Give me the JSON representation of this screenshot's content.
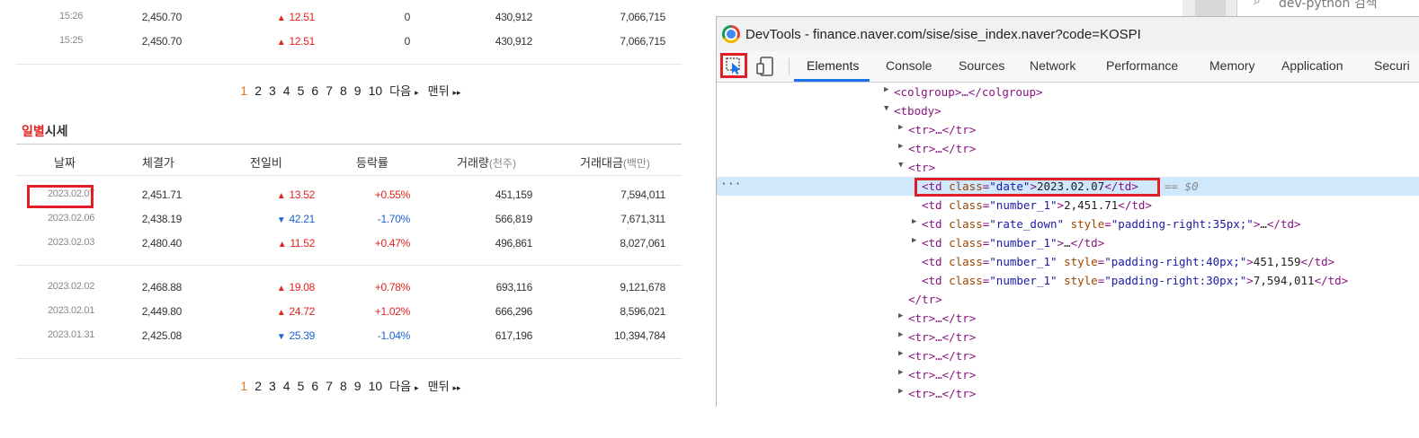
{
  "intraday_rows": [
    {
      "time": "15:26",
      "price": "2,450.70",
      "change": "12.51",
      "col4": "0",
      "vol": "430,912",
      "amount": "7,066,715"
    },
    {
      "time": "15:25",
      "price": "2,450.70",
      "change": "12.51",
      "col4": "0",
      "vol": "430,912",
      "amount": "7,066,715"
    }
  ],
  "pager": {
    "pages": [
      "1",
      "2",
      "3",
      "4",
      "5",
      "6",
      "7",
      "8",
      "9",
      "10"
    ],
    "next": "다음",
    "last": "맨뒤"
  },
  "daily": {
    "title_accent": "일별",
    "title_rest": "시세",
    "headers": {
      "date": "날짜",
      "close": "체결가",
      "change": "전일비",
      "rate": "등락률",
      "volume": "거래량",
      "volume_unit": "(천주)",
      "amount": "거래대금",
      "amount_unit": "(백만)"
    },
    "rows": [
      {
        "date": "2023.02.07",
        "price": "2,451.71",
        "dir": "up",
        "change": "13.52",
        "rate": "+0.55%",
        "vol": "451,159",
        "amount": "7,594,011"
      },
      {
        "date": "2023.02.06",
        "price": "2,438.19",
        "dir": "down",
        "change": "42.21",
        "rate": "-1.70%",
        "vol": "566,819",
        "amount": "7,671,311"
      },
      {
        "date": "2023.02.03",
        "price": "2,480.40",
        "dir": "up",
        "change": "11.52",
        "rate": "+0.47%",
        "vol": "496,861",
        "amount": "8,027,061"
      },
      {
        "date": "2023.02.02",
        "price": "2,468.88",
        "dir": "up",
        "change": "19.08",
        "rate": "+0.78%",
        "vol": "693,116",
        "amount": "9,121,678"
      },
      {
        "date": "2023.02.01",
        "price": "2,449.80",
        "dir": "up",
        "change": "24.72",
        "rate": "+1.02%",
        "vol": "666,296",
        "amount": "8,596,021"
      },
      {
        "date": "2023.01.31",
        "price": "2,425.08",
        "dir": "down",
        "change": "25.39",
        "rate": "-1.04%",
        "vol": "617,196",
        "amount": "10,394,784"
      }
    ]
  },
  "devtools": {
    "window_title": "DevTools - finance.naver.com/sise/sise_index.naver?code=KOSPI",
    "tabs": [
      "Elements",
      "Console",
      "Sources",
      "Network",
      "Performance",
      "Memory",
      "Application",
      "Securi"
    ],
    "dom": {
      "colgroup": "<colgroup>…</colgroup>",
      "tbody_open": "<tbody>",
      "tr_collapsed": "<tr>…</tr>",
      "tr_open": "<tr>",
      "tr_close": "</tr>",
      "selected_line": "<td class=\"date\">2023.02.07</td>",
      "selected_suffix": "== $0",
      "td_number_price": "<td class=\"number_1\">2,451.71</td>",
      "td_rate_down": "<td class=\"rate_down\" style=\"padding-right:35px;\">…</td>",
      "td_number_collapsed": "<td class=\"number_1\">…</td>",
      "td_vol": "<td class=\"number_1\" style=\"padding-right:40px;\">451,159</td>",
      "td_amount": "<td class=\"number_1\" style=\"padding-right:30px;\">7,594,011</td>",
      "ellipsis": "···"
    }
  },
  "taskbar": {
    "search_text": "dev-python 검색"
  },
  "colors": {
    "up": "#e2221d",
    "down": "#1b61d1",
    "page_current": "#e4741b",
    "highlight": "#e01f26",
    "devtools_accent": "#1a73e8"
  }
}
